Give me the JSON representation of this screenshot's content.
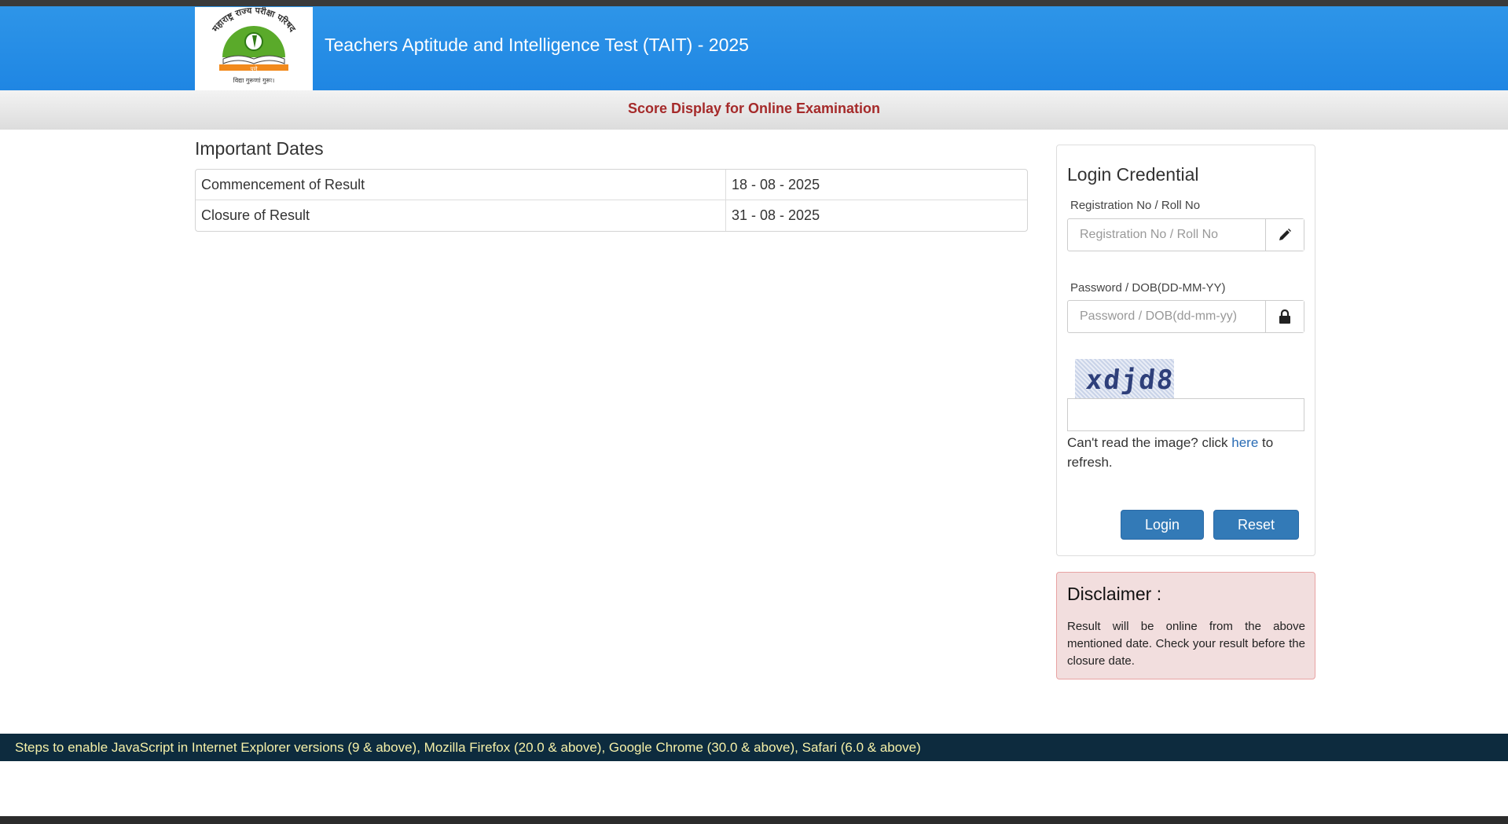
{
  "header": {
    "title": "Teachers Aptitude and Intelligence Test (TAIT) - 2025",
    "logo": {
      "icon": "emblem-logo-icon",
      "arc_text": "महाराष्ट्र राज्य परीक्षा परिषद",
      "motto": "विद्या गुरूणां गुरूः।",
      "city": "पुणे"
    }
  },
  "subheader": {
    "text": "Score Display for Online Examination"
  },
  "important_dates": {
    "heading": "Important Dates",
    "rows": [
      {
        "label": "Commencement of Result",
        "value": "18 - 08 - 2025"
      },
      {
        "label": "Closure of Result",
        "value": "31 - 08 - 2025"
      }
    ]
  },
  "login": {
    "title": "Login Credential",
    "registration": {
      "label": "Registration No / Roll No",
      "placeholder": "Registration No / Roll No",
      "icon": "pencil-icon"
    },
    "password": {
      "label": "Password / DOB(DD-MM-YY)",
      "placeholder": "Password / DOB(dd-mm-yy)",
      "icon": "lock-icon"
    },
    "captcha": {
      "text": "xdjd8",
      "help_before": "Can't read the image? click",
      "help_link": "here",
      "help_after": "to refresh."
    },
    "login_label": "Login",
    "reset_label": "Reset"
  },
  "disclaimer": {
    "title": "Disclaimer :",
    "text": "Result will be online from the above mentioned date. Check your result before the closure date."
  },
  "footer": {
    "text": "Steps to enable JavaScript in Internet Explorer versions (9 & above), Mozilla Firefox (20.0 & above), Google Chrome (30.0 & above), Safari (6.0 & above)"
  },
  "colors": {
    "header_blue": "#2e95e8",
    "subheader_text": "#a52a2a",
    "button_blue": "#337ab7",
    "footer_bg": "#0d2b3e",
    "footer_text": "#f5f0a8",
    "disclaimer_bg": "#f2dede"
  }
}
